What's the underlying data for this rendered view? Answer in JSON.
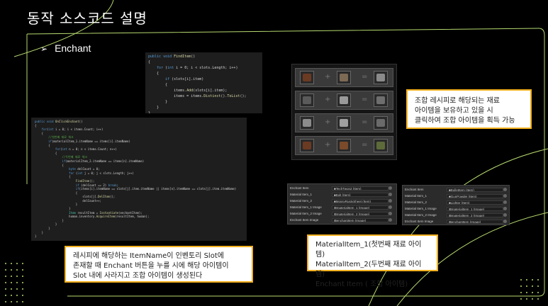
{
  "slide": {
    "title": "동작 소스코드 설명",
    "bullet": "Enchant"
  },
  "code_top": {
    "lines": [
      "public void FindItem()",
      "{",
      "    for (int i = 0; i < slots.Length; i++)",
      "    {",
      "        if (slots[i].item)",
      "        {",
      "            items.Add(slots[i].item);",
      "            items = items.Distinct().ToList();",
      "        }",
      "    }",
      "}"
    ]
  },
  "code_main": {
    "lines": [
      "public void OnClickEnchant()",
      "{",
      "    for(int i = 0; i < items.Count; i++)",
      "    {",
      "        //첫번째 재료 체크",
      "        if(materialItem_1.itemName == items[i].itemName)",
      "        {",
      "            for(int n = 0; n < items.Count; n++)",
      "            {",
      "                //두번째 재료 체크",
      "                if(materialItem_2.itemName == items[n].itemName)",
      "                {",
      "                    byte delCount = 0;",
      "                    for (int j = 0; j < slots.Length; j++)",
      "                    {",
      "                        FindItem();",
      "                        if (delCount == 2) break;",
      "                        if(items[i].itemName == slots[j].item.itemName || items[n].itemName == slots[j].item.itemName)",
      "                        {",
      "                            slots[j].DelItem();",
      "                            delCount++;",
      "                        }",
      "                    }",
      "                    Item resultItem = Instantiate(enchantItem);",
      "                    human.inventory.AcquireItem(resultItem, human);",
      "                }",
      "            }",
      "        }",
      "    }",
      "}"
    ]
  },
  "inventory": {
    "rows": [
      {
        "colors": [
          "#6b3a22",
          "#7d6a55",
          "#8a8a8a"
        ]
      },
      {
        "colors": [
          "#5a5a5a",
          "#9a9a9a",
          "#6e6e6e"
        ]
      },
      {
        "colors": [
          "#8c8c8c",
          "#a0a0a0",
          "#6a6a6a"
        ]
      },
      {
        "colors": [
          "#6b3a22",
          "#7a4a2a",
          "#5d6a3a"
        ]
      }
    ],
    "plus_symbol": "+",
    "equals_symbol": "="
  },
  "callouts": {
    "recipe": [
      "조합 레시피로 해당되는 재료",
      "아이템을 보유하고 있을 시",
      "클릭하여 조합 아이템을 획득 가능"
    ],
    "slot": [
      "레시피에 해당하는 ItemName이 인벤토리 Slot에",
      "존재할 때 Enchant 버튼을 누를 시에 해당 아이템이",
      "Slot 내에 사라지고 조합 아이템이 생성된다"
    ],
    "material": [
      "MaterialItem_1(첫번째 재료 아이템)",
      "MaterialItem_2(두번째 재료 아이템)",
      "Enchant Item ( 조합 아이템)"
    ]
  },
  "inspector_left": {
    "rows": [
      {
        "label": "Enchant Item",
        "value": "■TechTwon2 (Item)"
      },
      {
        "label": "Material Item_1",
        "value": "■Bolt (Item)"
      },
      {
        "label": "Material Item_2",
        "value": "■MossyRustySheet (Item)"
      },
      {
        "label": "Material Item_1 Image",
        "value": "⊠materialItem_1 (Image)"
      },
      {
        "label": "Material Item_2 Image",
        "value": "⊠materialItem_2 (Image)"
      },
      {
        "label": "Enchant Item Image",
        "value": "⊠enchantItem (Image)"
      }
    ]
  },
  "inspector_right": {
    "rows": [
      {
        "label": "Enchant Item",
        "value": "■BulletItem (Item)"
      },
      {
        "label": "Material Item_1",
        "value": "■GunPowder (Item)"
      },
      {
        "label": "Material Item_2",
        "value": "■Lighter (Item)"
      },
      {
        "label": "Material Item_1 Image",
        "value": "⊠materialItem_1 (Image)"
      },
      {
        "label": "Material Item_2 Image",
        "value": "⊠materialItem_2 (Image)"
      },
      {
        "label": "Enchant Item Image",
        "value": "⊠enchantItem (Image)"
      }
    ]
  },
  "colors": {
    "accent_green": "#b6d96e",
    "callout_border": "#f2b01e"
  }
}
